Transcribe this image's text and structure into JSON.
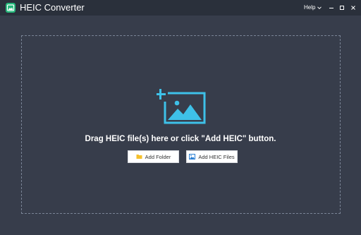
{
  "app": {
    "title": "HEIC Converter",
    "logo_icon": "heic-converter-logo-icon"
  },
  "titlebar": {
    "help_label": "Help",
    "controls": [
      "minimize-icon",
      "maximize-icon",
      "close-icon"
    ]
  },
  "dropzone": {
    "icon": "add-image-icon",
    "instruction": "Drag HEIC file(s) here or click \"Add HEIC\" button."
  },
  "buttons": {
    "add_folder_label": "Add Folder",
    "add_folder_icon": "folder-icon",
    "add_heic_label": "Add HEIC Files",
    "add_heic_icon": "image-icon"
  },
  "colors": {
    "background": "#373d4b",
    "titlebar": "#2a303b",
    "accent": "#3ec1e8",
    "folder_yellow": "#f5c02c",
    "logo_green": "#24b77a"
  }
}
